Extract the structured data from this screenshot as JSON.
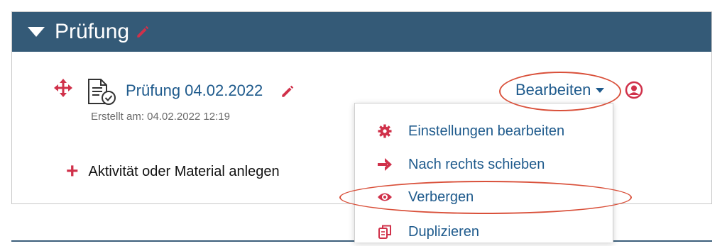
{
  "section": {
    "title": "Prüfung",
    "header_color": "#345a77"
  },
  "activity": {
    "name": "Prüfung 04.02.2022",
    "meta": "Erstellt am: 04.02.2022 12:19",
    "icon": "quiz-document-check-icon"
  },
  "edit_menu": {
    "label": "Bearbeiten",
    "items": [
      {
        "label": "Einstellungen bearbeiten",
        "icon": "gear-icon"
      },
      {
        "label": "Nach rechts schieben",
        "icon": "arrow-right-icon"
      },
      {
        "label": "Verbergen",
        "icon": "eye-icon"
      },
      {
        "label": "Duplizieren",
        "icon": "duplicate-icon"
      }
    ]
  },
  "add_activity": {
    "label": "Aktivität oder Material anlegen"
  },
  "colors": {
    "accent": "#d0314a",
    "link": "#1e5a8c",
    "annotation": "#d9503a"
  }
}
